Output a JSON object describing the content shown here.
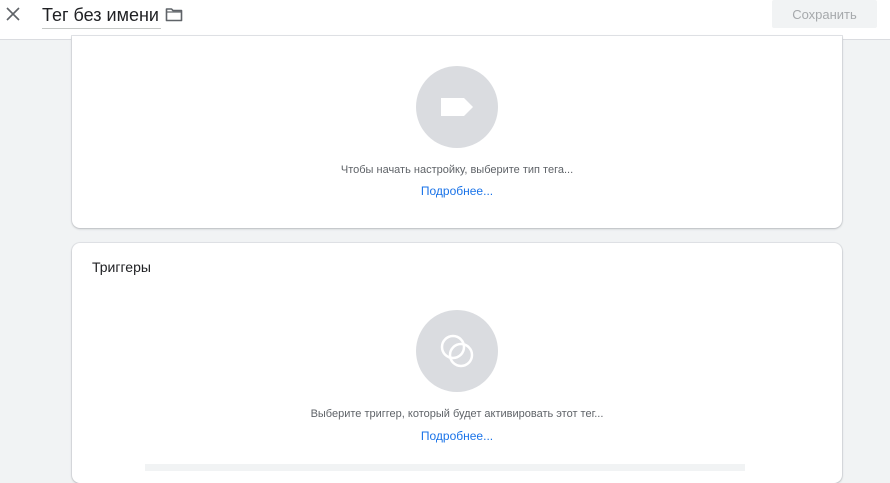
{
  "header": {
    "title": "Тег без имени",
    "save_label": "Сохранить",
    "close_icon": "close-icon",
    "folder_icon": "folder-icon"
  },
  "tag_config": {
    "icon": "tag-icon",
    "hint": "Чтобы начать настройку, выберите тип тега...",
    "link": "Подробнее..."
  },
  "triggers": {
    "title": "Триггеры",
    "icon": "trigger-circles-icon",
    "hint": "Выберите триггер, который будет активировать этот тег...",
    "link": "Подробнее..."
  },
  "colors": {
    "link": "#1a73e8",
    "placeholder_circle": "#dadce0",
    "background": "#f1f3f4"
  }
}
